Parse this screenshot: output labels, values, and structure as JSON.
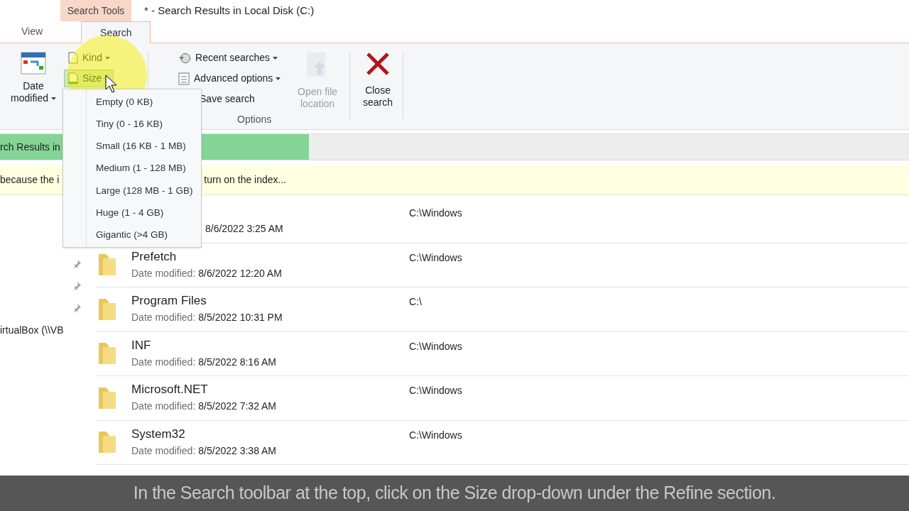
{
  "title_bar": {
    "context_tab": "Search Tools",
    "title": "* - Search Results in Local Disk (C:)"
  },
  "tabs": [
    {
      "label": "View",
      "selected": false
    },
    {
      "label": "Search",
      "selected": true
    }
  ],
  "ribbon": {
    "date_modified": {
      "label": "Date modified",
      "dropdown": true
    },
    "refine": [
      {
        "label": "Kind",
        "selected": false
      },
      {
        "label": "Size",
        "selected": true
      }
    ],
    "options": [
      {
        "label": "Recent searches",
        "dropdown": true
      },
      {
        "label": "Advanced options",
        "dropdown": true
      },
      {
        "label": "Save search",
        "dropdown": false
      }
    ],
    "options_label": "Options",
    "open_file_location": {
      "label": "Open file location",
      "disabled": true
    },
    "close_search": {
      "label": "Close search"
    }
  },
  "address_bar": {
    "text": "rch Results in",
    "level": 0.34
  },
  "info_bar": [
    "because the i",
    "turn on the index..."
  ],
  "nav": {
    "item": "irtualBox (\\\\VB"
  },
  "size_menu": [
    "Empty (0 KB)",
    "Tiny (0 - 16 KB)",
    "Small (16 KB - 1 MB)",
    "Medium (1 - 128 MB)",
    "Large (128 MB - 1 GB)",
    "Huge (1 - 4 GB)",
    "Gigantic (>4 GB)"
  ],
  "results": [
    {
      "date": "8/6/2022 3:25 AM",
      "path": "C:\\Windows"
    },
    {
      "name": "Prefetch",
      "date_label": "Date modified:",
      "date": "8/6/2022 12:20 AM",
      "path": "C:\\Windows"
    },
    {
      "name": "Program Files",
      "date_label": "Date modified:",
      "date": "8/5/2022 10:31 PM",
      "path": "C:\\"
    },
    {
      "name": "INF",
      "date_label": "Date modified:",
      "date": "8/5/2022 8:16 AM",
      "path": "C:\\Windows"
    },
    {
      "name": "Microsoft.NET",
      "date_label": "Date modified:",
      "date": "8/5/2022 7:32 AM",
      "path": "C:\\Windows"
    },
    {
      "name": "System32",
      "date_label": "Date modified:",
      "date": "8/5/2022 3:38 AM",
      "path": "C:\\Windows"
    }
  ],
  "subtitle": "In the Search toolbar at the top, click on the Size drop-down under the Refine section."
}
